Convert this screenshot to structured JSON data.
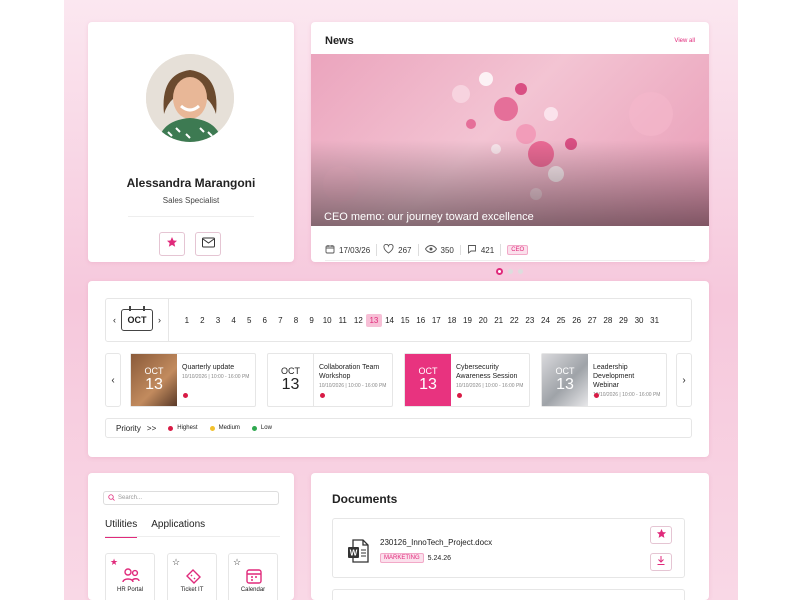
{
  "profile": {
    "name": "Alessandra Marangoni",
    "role": "Sales Specialist"
  },
  "news": {
    "title": "News",
    "view_all": "View all",
    "caption": "CEO memo: our journey toward excellence",
    "date": "17/03/26",
    "likes": "267",
    "views": "350",
    "comments": "421",
    "tag": "CEO"
  },
  "calendar": {
    "month": "OCT",
    "days": [
      "1",
      "2",
      "3",
      "4",
      "5",
      "6",
      "7",
      "8",
      "9",
      "10",
      "11",
      "12",
      "13",
      "14",
      "15",
      "16",
      "17",
      "18",
      "19",
      "20",
      "21",
      "22",
      "23",
      "24",
      "25",
      "26",
      "27",
      "28",
      "29",
      "30",
      "31"
    ],
    "selected_day": "13",
    "events": [
      {
        "month": "OCT",
        "day": "13",
        "title": "Quarterly update",
        "date": "10/10/2026 | 10:00 - 16:00 PM"
      },
      {
        "month": "OCT",
        "day": "13",
        "title": "Collaboration Team Workshop",
        "date": "10/10/2026 | 10:00 - 16:00 PM"
      },
      {
        "month": "OCT",
        "day": "13",
        "title": "Cybersecurity Awareness Session",
        "date": "10/10/2026 | 10:00 - 16:00 PM"
      },
      {
        "month": "OCT",
        "day": "13",
        "title": "Leadership Development Webinar",
        "date": "10/10/2026 | 10:00 - 16:00 PM"
      }
    ],
    "priority_label": "Priority",
    "priority_arrows": ">>",
    "priority_levels": [
      {
        "label": "Highest",
        "color": "#d81b45"
      },
      {
        "label": "Medium",
        "color": "#f2c12e"
      },
      {
        "label": "Low",
        "color": "#2fa84f"
      }
    ]
  },
  "utilities": {
    "search_placeholder": "Search...",
    "tabs": [
      "Utilities",
      "Applications"
    ],
    "active_tab": "Utilities",
    "tiles": [
      {
        "label": "HR Portal",
        "icon": "people-icon",
        "favorite": true
      },
      {
        "label": "Ticket IT",
        "icon": "ticket-icon",
        "favorite": false
      },
      {
        "label": "Calendar",
        "icon": "calendar-icon",
        "favorite": false
      }
    ]
  },
  "documents": {
    "title": "Documents",
    "items": [
      {
        "name": "230126_InnoTech_Project.docx",
        "tag": "MARKETING",
        "version": "5.24.26"
      }
    ]
  },
  "colors": {
    "accent": "#e02a7b",
    "background": "#f6c8dc",
    "high": "#d81b45",
    "medium": "#f2c12e",
    "low": "#2fa84f"
  }
}
